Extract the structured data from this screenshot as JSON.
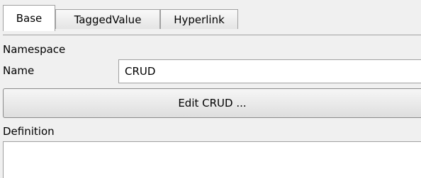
{
  "tabs": [
    {
      "label": "Base",
      "active": true
    },
    {
      "label": "TaggedValue",
      "active": false
    },
    {
      "label": "Hyperlink",
      "active": false
    }
  ],
  "fields": {
    "namespace_label": "Namespace",
    "name_label": "Name",
    "name_value": "CRUD",
    "edit_button_label": "Edit CRUD ...",
    "definition_label": "Definition",
    "definition_value": ""
  },
  "colors": {
    "background": "#f0f0f0",
    "border": "#a0a0a0",
    "field_background": "#ffffff"
  }
}
